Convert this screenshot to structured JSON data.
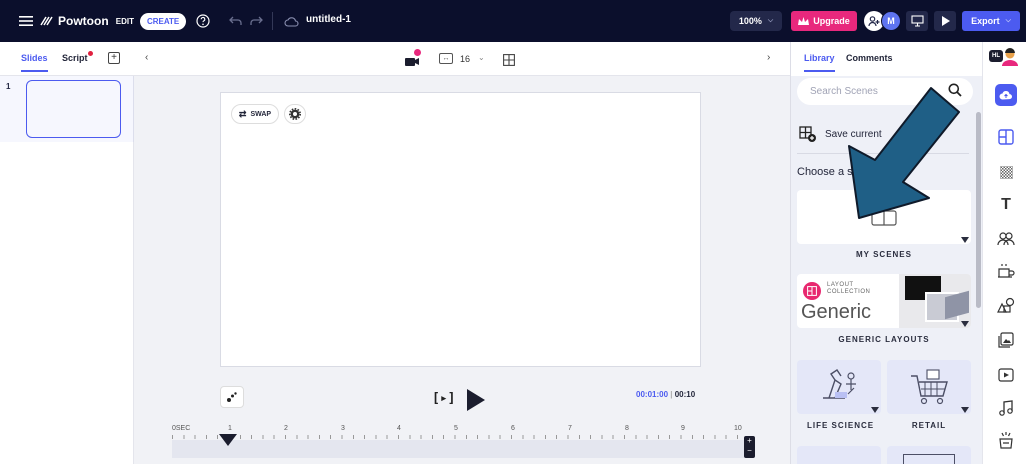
{
  "topbar": {
    "brand": "Powtoon",
    "mode_edit": "EDIT",
    "mode_create": "CREATE",
    "title": "untitled-1",
    "zoom": "100%",
    "upgrade": "Upgrade",
    "avatar_initial": "M",
    "export": "Export"
  },
  "subbar": {
    "tab_slides": "Slides",
    "tab_script": "Script",
    "ratio_value": "16"
  },
  "slides": {
    "first_number": "1"
  },
  "canvas": {
    "swap_label": "SWAP"
  },
  "timeline": {
    "current_time": "00:01:00",
    "total_time": "00:10",
    "ticks": [
      "0SEC",
      "1",
      "2",
      "3",
      "4",
      "5",
      "6",
      "7",
      "8",
      "9",
      "10"
    ]
  },
  "rightpanel": {
    "tab_library": "Library",
    "tab_comments": "Comments",
    "search_placeholder": "Search Scenes",
    "save_current": "Save current",
    "choose_label": "Choose a s",
    "my_scenes": "MY SCENES",
    "layout_collection_line1": "LAYOUT",
    "layout_collection_line2": "COLLECTION",
    "generic_word": "Generic",
    "generic_layouts": "GENERIC LAYOUTS",
    "life_science": "LIFE SCIENCE",
    "retail": "RETAIL"
  },
  "rail": {
    "avatar_badge": "HL"
  },
  "colors": {
    "topbar": "#0b0f2c",
    "accent_blue": "#4c5bf0",
    "upgrade_pink": "#e8287d",
    "arrow_teal": "#1f5f86"
  }
}
